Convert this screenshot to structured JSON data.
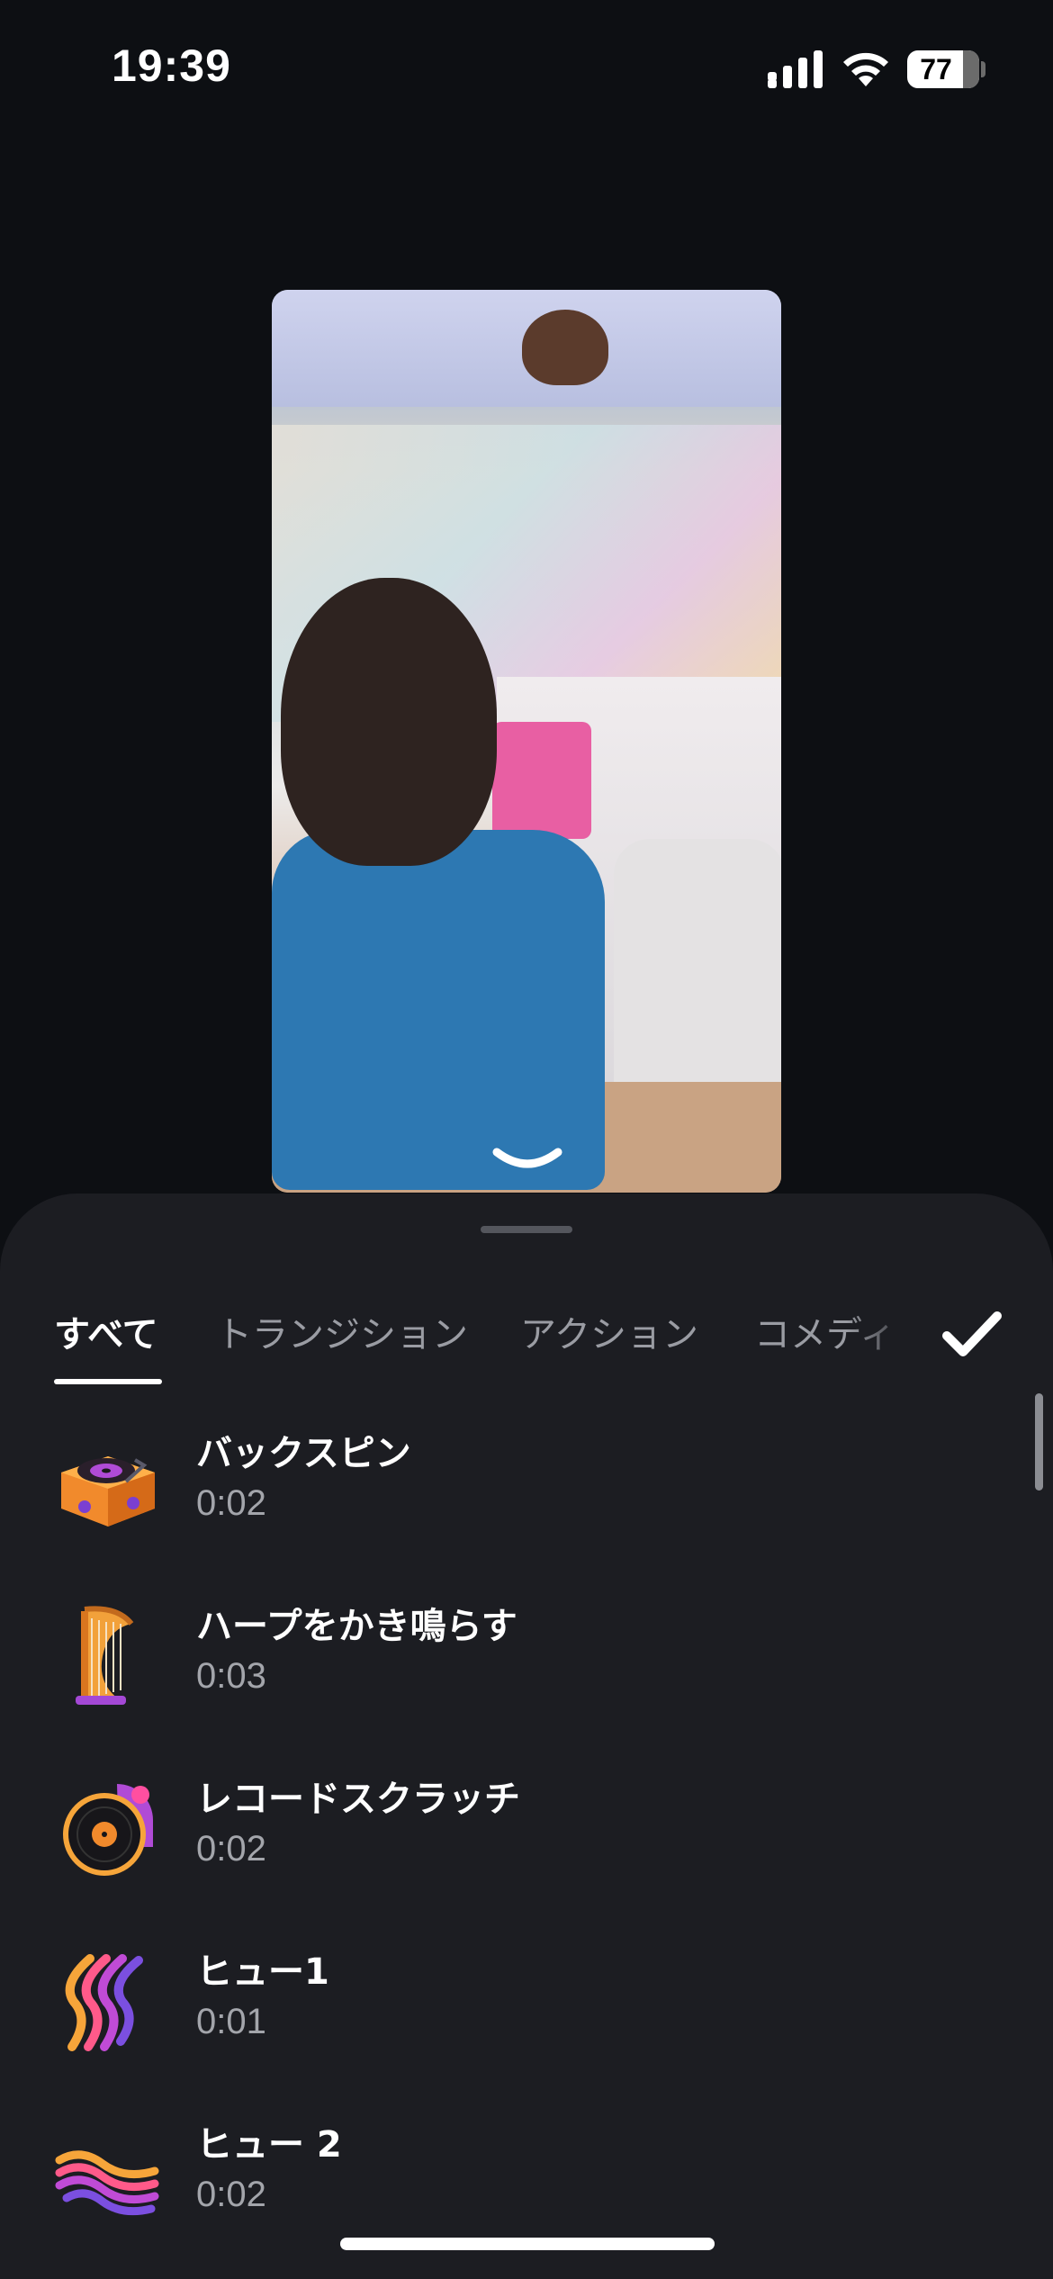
{
  "status_bar": {
    "time": "19:39",
    "battery_level": "77"
  },
  "tabs": [
    {
      "label": "すべて",
      "active": true
    },
    {
      "label": "トランジション",
      "active": false
    },
    {
      "label": "アクション",
      "active": false
    },
    {
      "label": "コメディ",
      "active": false
    }
  ],
  "sounds": [
    {
      "title": "バックスピン",
      "duration": "0:02",
      "icon": "turntable-icon"
    },
    {
      "title": "ハープをかき鳴らす",
      "duration": "0:03",
      "icon": "harp-icon"
    },
    {
      "title": "レコードスクラッチ",
      "duration": "0:02",
      "icon": "vinyl-record-icon"
    },
    {
      "title": "ヒュー1",
      "duration": "0:01",
      "icon": "whoosh-wave-icon"
    },
    {
      "title": "ヒュー 2",
      "duration": "0:02",
      "icon": "whoosh-wave-icon"
    }
  ],
  "colors": {
    "background": "#0d0f13",
    "sheet": "#1c1d22",
    "text": "#ffffff",
    "muted": "#a3a5ab"
  }
}
